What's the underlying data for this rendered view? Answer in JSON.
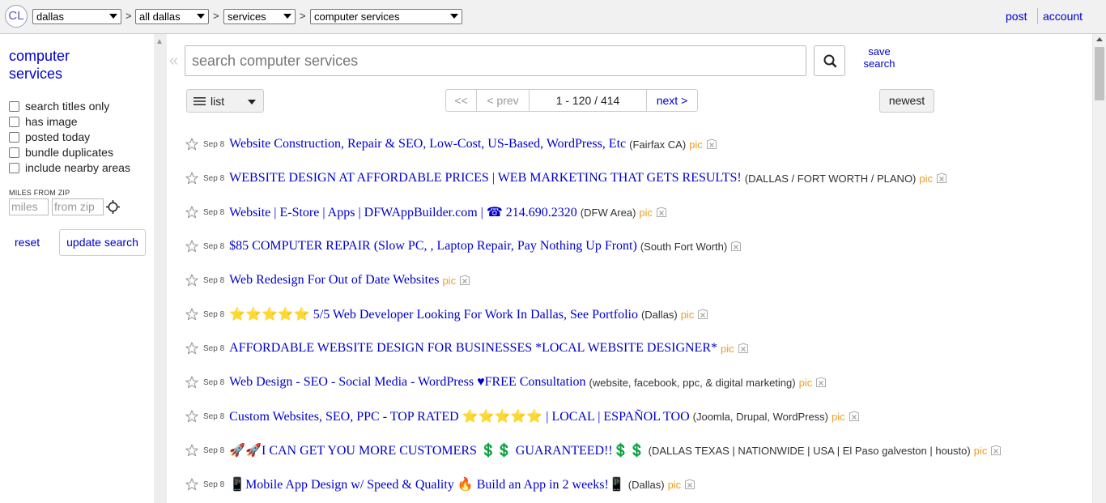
{
  "header": {
    "logo": "CL",
    "selects": [
      "dallas",
      "all dallas",
      "services",
      "computer services"
    ],
    "separator": ">",
    "post": "post",
    "account": "account"
  },
  "sidebar": {
    "category_line1": "computer",
    "category_line2": "services",
    "checkboxes": [
      "search titles only",
      "has image",
      "posted today",
      "bundle duplicates",
      "include nearby areas"
    ],
    "miles_label": "MILES FROM ZIP",
    "miles_placeholder": "miles",
    "zip_placeholder": "from zip",
    "reset": "reset",
    "update": "update search"
  },
  "search": {
    "placeholder": "search computer services",
    "save_line1": "save",
    "save_line2": "search"
  },
  "toolbar": {
    "view": "list",
    "first": "<<",
    "prev": "< prev",
    "range": "1 - 120 / 414",
    "next": "next >",
    "sort": "newest"
  },
  "results": [
    {
      "date": "Sep 8",
      "title": "Website Construction, Repair & SEO, Low-Cost, US-Based, WordPress, Etc",
      "loc": "(Fairfax CA)",
      "pic": "pic"
    },
    {
      "date": "Sep 8",
      "title": "WEBSITE DESIGN AT AFFORDABLE PRICES | WEB MARKETING THAT GETS RESULTS!",
      "loc": "(DALLAS / FORT WORTH / PLANO)",
      "pic": "pic"
    },
    {
      "date": "Sep 8",
      "title": "Website | E-Store | Apps | DFWAppBuilder.com | ☎ 214.690.2320",
      "loc": "(DFW Area)",
      "pic": "pic"
    },
    {
      "date": "Sep 8",
      "title": "$85 COMPUTER REPAIR (Slow PC, , Laptop Repair, Pay Nothing Up Front)",
      "loc": "(South Fort Worth)",
      "pic": ""
    },
    {
      "date": "Sep 8",
      "title": "Web Redesign For Out of Date Websites",
      "loc": "",
      "pic": "pic"
    },
    {
      "date": "Sep 8",
      "title": "⭐⭐⭐⭐⭐ 5/5 Web Developer Looking For Work In Dallas, See Portfolio",
      "loc": "(Dallas)",
      "pic": "pic"
    },
    {
      "date": "Sep 8",
      "title": "AFFORDABLE WEBSITE DESIGN FOR BUSINESSES *LOCAL WEBSITE DESIGNER*",
      "loc": "",
      "pic": "pic"
    },
    {
      "date": "Sep 8",
      "title": "Web Design - SEO - Social Media - WordPress ♥FREE Consultation",
      "loc": "(website, facebook, ppc, & digital marketing)",
      "pic": "pic"
    },
    {
      "date": "Sep 8",
      "title": "Custom Websites, SEO, PPC - TOP RATED ⭐⭐⭐⭐⭐ | LOCAL | ESPAÑOL TOO",
      "loc": "(Joomla, Drupal, WordPress)",
      "pic": "pic"
    },
    {
      "date": "Sep 8",
      "title": "🚀🚀I CAN GET YOU MORE CUSTOMERS 💲💲 GUARANTEED!!💲💲",
      "loc": "(DALLAS TEXAS | NATIONWIDE | USA | El Paso galveston | housto)",
      "pic": "pic"
    },
    {
      "date": "Sep 8",
      "title": "📱Mobile App Design w/ Speed & Quality 🔥 Build an App in 2 weeks!📱",
      "loc": "(Dallas)",
      "pic": "pic"
    }
  ]
}
